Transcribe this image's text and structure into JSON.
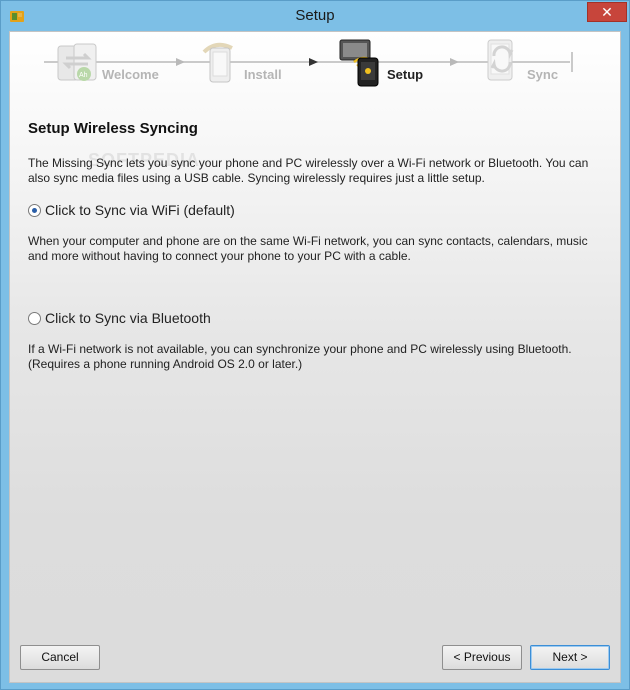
{
  "window": {
    "title": "Setup"
  },
  "steps": [
    {
      "label": "Welcome",
      "active": false,
      "icon": "welcome-phone-icon"
    },
    {
      "label": "Install",
      "active": false,
      "icon": "install-phone-icon"
    },
    {
      "label": "Setup",
      "active": true,
      "icon": "wireless-setup-icon"
    },
    {
      "label": "Sync",
      "active": false,
      "icon": "sync-phone-icon"
    }
  ],
  "content": {
    "heading": "Setup Wireless Syncing",
    "intro": "The Missing Sync lets you sync your phone and PC wirelessly over a Wi-Fi network or Bluetooth. You can also sync media files using a USB cable. Syncing wirelessly requires just a little setup.",
    "wifi": {
      "label": "Click to Sync via WiFi (default)",
      "checked": true,
      "description": "When your computer and phone are on the same Wi-Fi network, you can sync contacts, calendars, music and more without having to connect your phone to your PC with a cable."
    },
    "bluetooth": {
      "label": "Click to Sync via Bluetooth",
      "checked": false,
      "description": "If a Wi-Fi network is not available, you can synchronize your phone and PC wirelessly using Bluetooth. (Requires a phone running Android OS 2.0 or later.)"
    }
  },
  "buttons": {
    "cancel": "Cancel",
    "previous": "< Previous",
    "next": "Next >"
  },
  "watermark": "SOFTPEDIA",
  "colors": {
    "titlebar": "#7dbfe6",
    "close": "#c7453b",
    "active_step": "#222222",
    "inactive_step": "#b5b5b5",
    "default_button_border": "#3c8ed6"
  }
}
